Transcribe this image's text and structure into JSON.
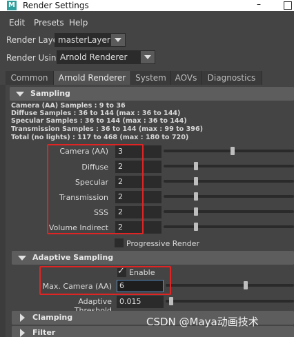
{
  "window": {
    "title": "Render Settings",
    "app_icon": "M"
  },
  "menu": [
    "Edit",
    "Presets",
    "Help"
  ],
  "render_layer": {
    "label": "Render Layer",
    "value": "masterLayer"
  },
  "render_using": {
    "label": "Render Using",
    "value": "Arnold Renderer"
  },
  "tabs": [
    "Common",
    "Arnold Renderer",
    "System",
    "AOVs",
    "Diagnostics"
  ],
  "sampling": {
    "header": "Sampling",
    "info": [
      "Camera (AA) Samples : 9 to 36",
      "Diffuse Samples : 36 to 144 (max : 36 to 144)",
      "Specular Samples : 36 to 144 (max : 36 to 144)",
      "Transmission Samples : 36 to 144 (max : 99 to 396)",
      "Total (no lights) : 117 to 468 (max : 180 to 720)"
    ],
    "fields": [
      {
        "label": "Camera (AA)",
        "value": "3",
        "level": 0.4
      },
      {
        "label": "Diffuse",
        "value": "2",
        "level": 0.25
      },
      {
        "label": "Specular",
        "value": "2",
        "level": 0.25
      },
      {
        "label": "Transmission",
        "value": "2",
        "level": 0.25
      },
      {
        "label": "SSS",
        "value": "2",
        "level": 0.25
      },
      {
        "label": "Volume Indirect",
        "value": "2",
        "level": 0.25
      }
    ],
    "progressive_render": {
      "label": "Progressive Render",
      "checked": false
    }
  },
  "adaptive": {
    "header": "Adaptive Sampling",
    "enable": {
      "label": "Enable",
      "checked": true
    },
    "max_camera": {
      "label": "Max. Camera (AA)",
      "value": "6",
      "level": 0.7
    },
    "threshold": {
      "label": "Adaptive Threshold",
      "value": "0.015",
      "level": 0.02
    }
  },
  "collapsed_sections": [
    "Clamping",
    "Filter"
  ],
  "watermark": "CSDN @Maya动画技术",
  "colors": {
    "highlight_box": "#e02424",
    "panel_bg": "#444444",
    "header_bg": "#5d5d5d"
  }
}
